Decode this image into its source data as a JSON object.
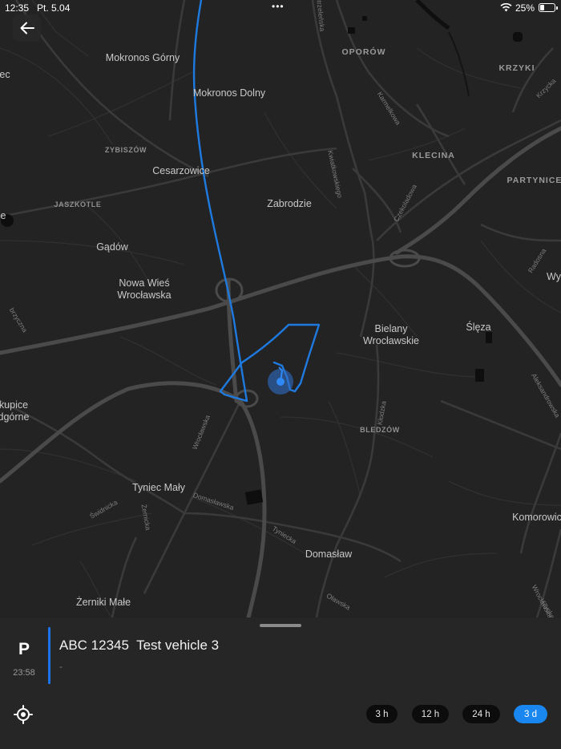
{
  "status_bar": {
    "time": "12:35",
    "date": "Pt. 5.04",
    "dots": "•••",
    "battery": "25%"
  },
  "map": {
    "places": [
      "Mokronos Górny",
      "Mokronos Dolny",
      "Cesarzowice",
      "Zabrodzie",
      "Gądów",
      "Nowa Wieś Wrocławska",
      "Bielany Wrocławskie",
      "Ślęza",
      "Tyniec Mały",
      "Domasław",
      "Żerniki Małe",
      "Komorowic",
      "Wy",
      "ec",
      "e",
      "kupice",
      "dgórne"
    ],
    "districts": [
      "OPORÓW",
      "KRZYKI",
      "KLECINA",
      "PARTYNICE",
      "ZYBISZÓW",
      "JASZKOTLE",
      "BLEDZÓW"
    ],
    "streets": [
      "Karmelkowa",
      "Kwiatkowskiego",
      "Czekoladowa",
      "Radosna",
      "Aleksandrowska",
      "Krzycka",
      "Wrocławska",
      "Kłodzka",
      "Świdnicka",
      "Żernicka",
      "Domasławska",
      "Tyniecka",
      "Oławska",
      "Wrocławska",
      "Strzeleńska",
      "brzyczna",
      "rzycka"
    ]
  },
  "vehicle": {
    "status_letter": "P",
    "status_time": "23:58",
    "title": "ABC 12345  Test vehicle 3",
    "subtitle": "-"
  },
  "time_ranges": [
    {
      "label": "3 h",
      "active": false
    },
    {
      "label": "12 h",
      "active": false
    },
    {
      "label": "24 h",
      "active": false
    },
    {
      "label": "3 d",
      "active": true
    }
  ],
  "colors": {
    "accent": "#1a86f0",
    "route": "#1f7ae0",
    "map_bg": "#232323",
    "road": "#444444"
  }
}
